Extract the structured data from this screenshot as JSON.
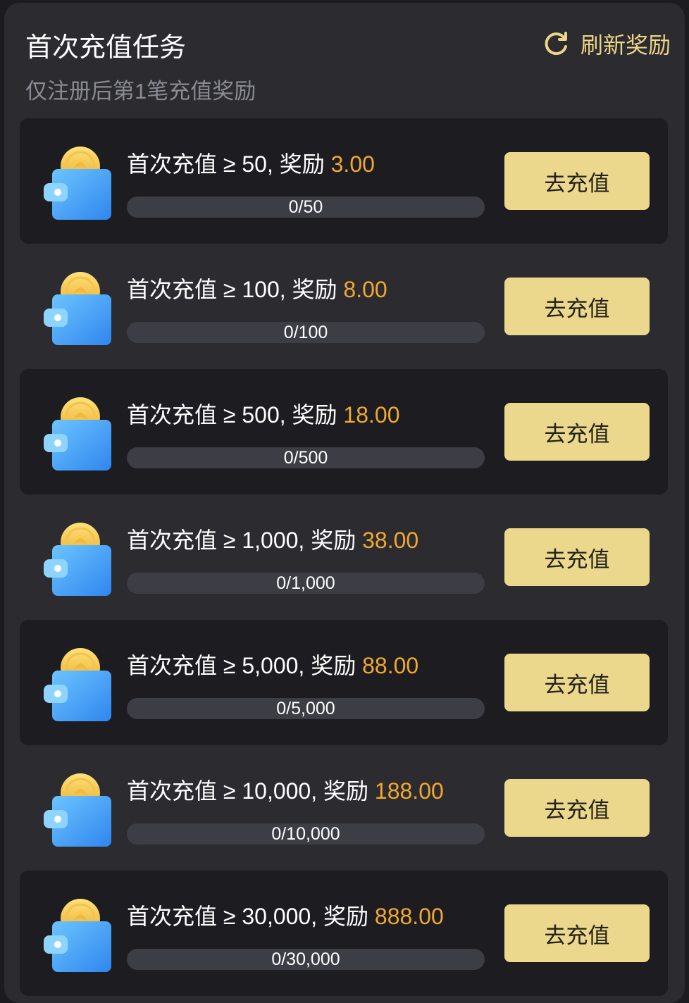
{
  "header": {
    "title": "首次充值任务",
    "subtitle": "仅注册后第1笔充值奖励",
    "refresh_label": "刷新奖励",
    "refresh_icon": "refresh-icon"
  },
  "colors": {
    "accent": "#ebd88d",
    "reward": "#f0a830",
    "background": "#2b2b30",
    "card": "#1d1d21"
  },
  "tasks": [
    {
      "prefix": "首次充值 ≥ 50, 奖励 ",
      "reward": "3.00",
      "progress_text": "0/50",
      "progress": 0,
      "button": "去充值",
      "icon": "wallet-coin-icon"
    },
    {
      "prefix": "首次充值 ≥ 100, 奖励 ",
      "reward": "8.00",
      "progress_text": "0/100",
      "progress": 0,
      "button": "去充值",
      "icon": "wallet-coin-icon"
    },
    {
      "prefix": "首次充值 ≥ 500, 奖励 ",
      "reward": "18.00",
      "progress_text": "0/500",
      "progress": 0,
      "button": "去充值",
      "icon": "wallet-coin-icon"
    },
    {
      "prefix": "首次充值 ≥ 1,000, 奖励 ",
      "reward": "38.00",
      "progress_text": "0/1,000",
      "progress": 0,
      "button": "去充值",
      "icon": "wallet-coin-icon"
    },
    {
      "prefix": "首次充值 ≥ 5,000, 奖励 ",
      "reward": "88.00",
      "progress_text": "0/5,000",
      "progress": 0,
      "button": "去充值",
      "icon": "wallet-coin-icon"
    },
    {
      "prefix": "首次充值 ≥ 10,000, 奖励 ",
      "reward": "188.00",
      "progress_text": "0/10,000",
      "progress": 0,
      "button": "去充值",
      "icon": "wallet-coin-icon"
    },
    {
      "prefix": "首次充值 ≥ 30,000, 奖励 ",
      "reward": "888.00",
      "progress_text": "0/30,000",
      "progress": 0,
      "button": "去充值",
      "icon": "wallet-coin-icon"
    }
  ]
}
